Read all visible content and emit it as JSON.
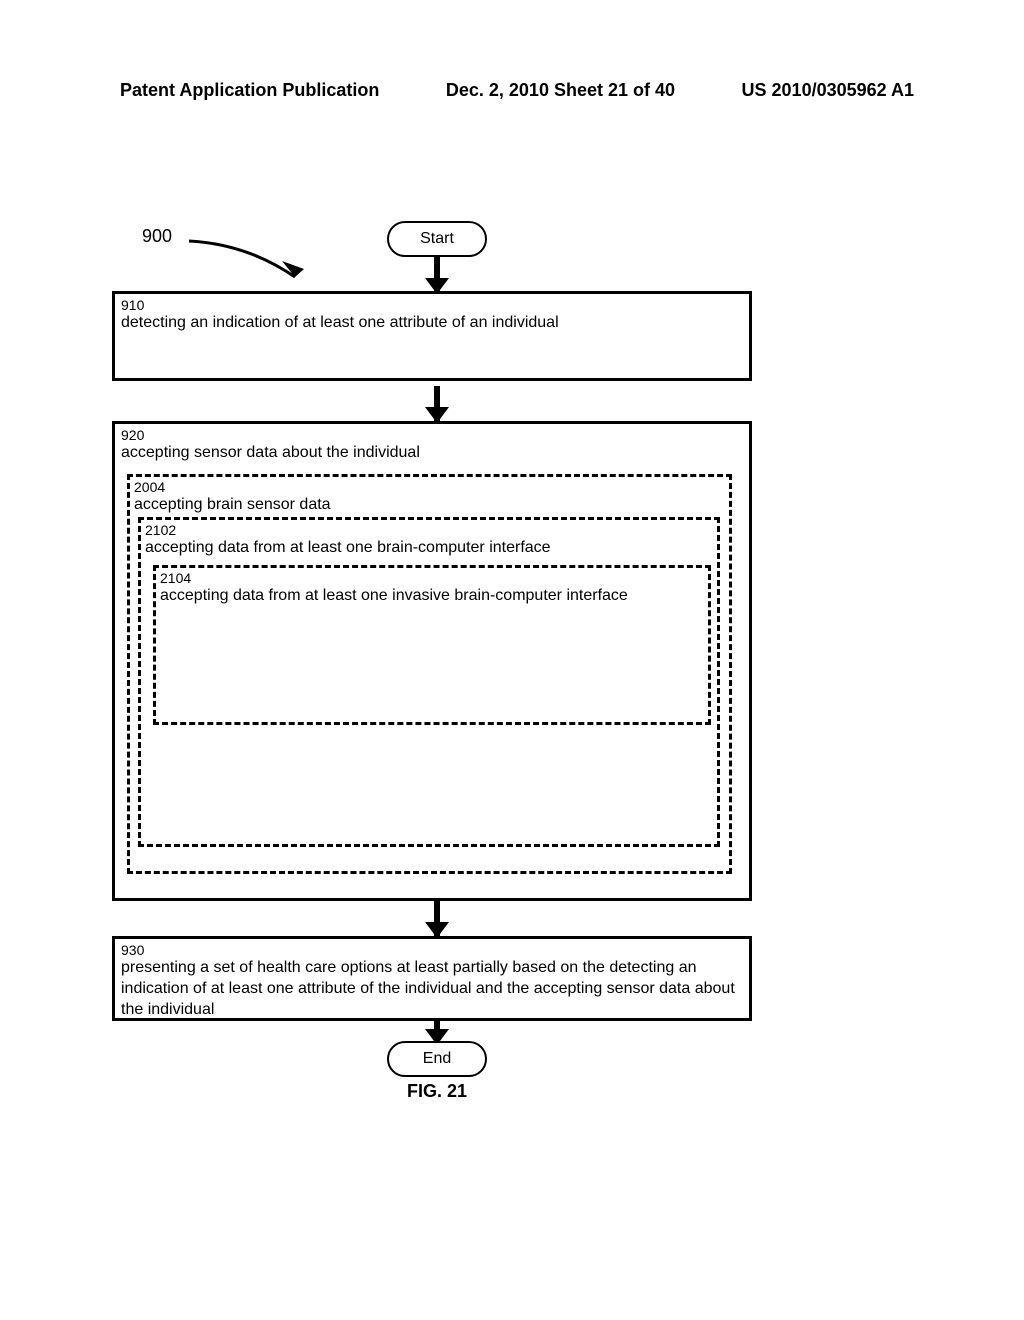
{
  "header": {
    "left": "Patent Application Publication",
    "center": "Dec. 2, 2010  Sheet 21 of 40",
    "right": "US 2010/0305962 A1"
  },
  "flowchart": {
    "ref": "900",
    "start": "Start",
    "end": "End",
    "figure": "FIG. 21",
    "box910": {
      "num": "910",
      "text": "detecting an indication of at least one attribute of an individual"
    },
    "box920": {
      "num": "920",
      "text": "accepting sensor data about the individual"
    },
    "box2004": {
      "num": "2004",
      "text": "accepting brain sensor data"
    },
    "box2102": {
      "num": "2102",
      "text": "accepting data from at least one brain-computer interface"
    },
    "box2104": {
      "num": "2104",
      "text": "accepting data from at least one invasive brain-computer interface"
    },
    "box930": {
      "num": "930",
      "text": "presenting a set of health care options at least partially based on the detecting an indication of at least one attribute of the individual and the accepting sensor data about the individual"
    }
  }
}
